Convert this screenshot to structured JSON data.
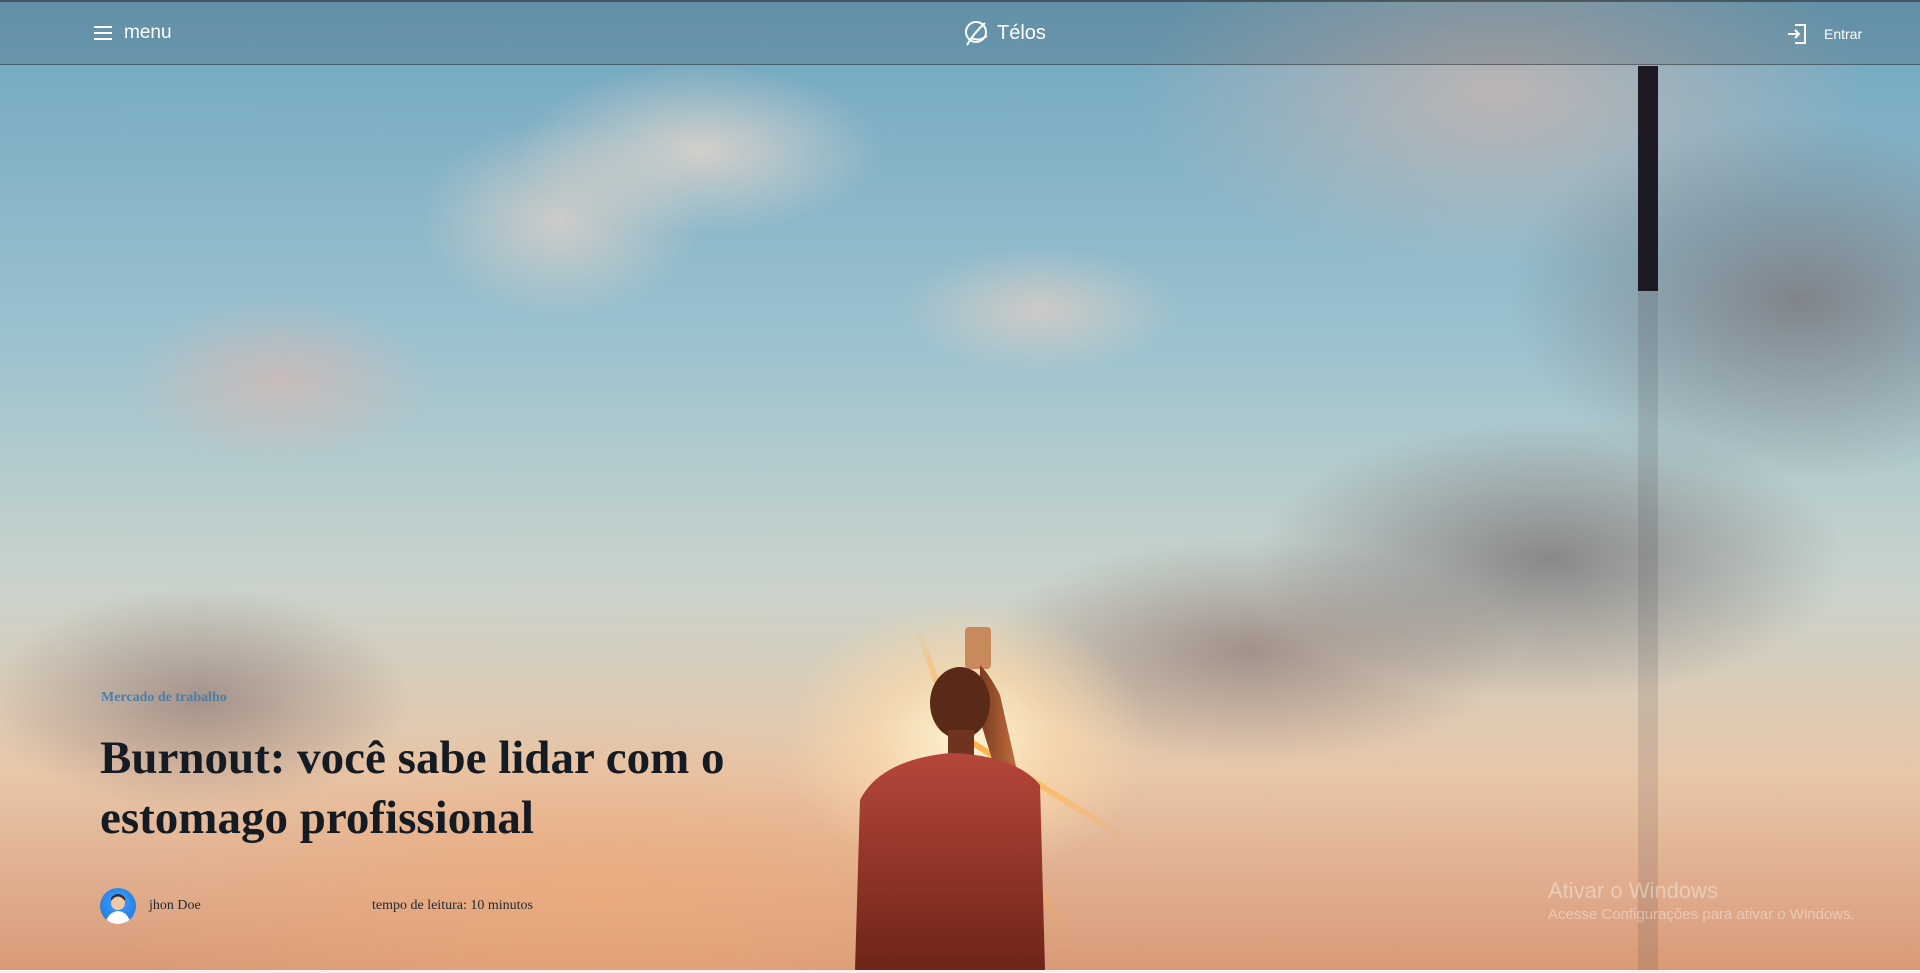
{
  "header": {
    "menu_label": "menu",
    "menu_icon": "hamburger-icon",
    "brand_name": "Télos",
    "brand_icon": "telos-logo-icon",
    "login_label": "Entrar",
    "login_icon": "login-icon"
  },
  "article": {
    "category": "Mercado de trabalho",
    "title": "Burnout: você sabe lidar com o estomago profissional",
    "author": "jhon Doe",
    "read_time": "tempo de leitura: 10 minutos"
  },
  "watermark": {
    "line1": "Ativar o Windows",
    "line2": "Acesse Configurações para ativar o Windows."
  },
  "colors": {
    "category_text": "#4d7fa6",
    "title_text": "#141b22",
    "header_text": "#ffffff",
    "scroll_thumb": "#1e1a24"
  }
}
